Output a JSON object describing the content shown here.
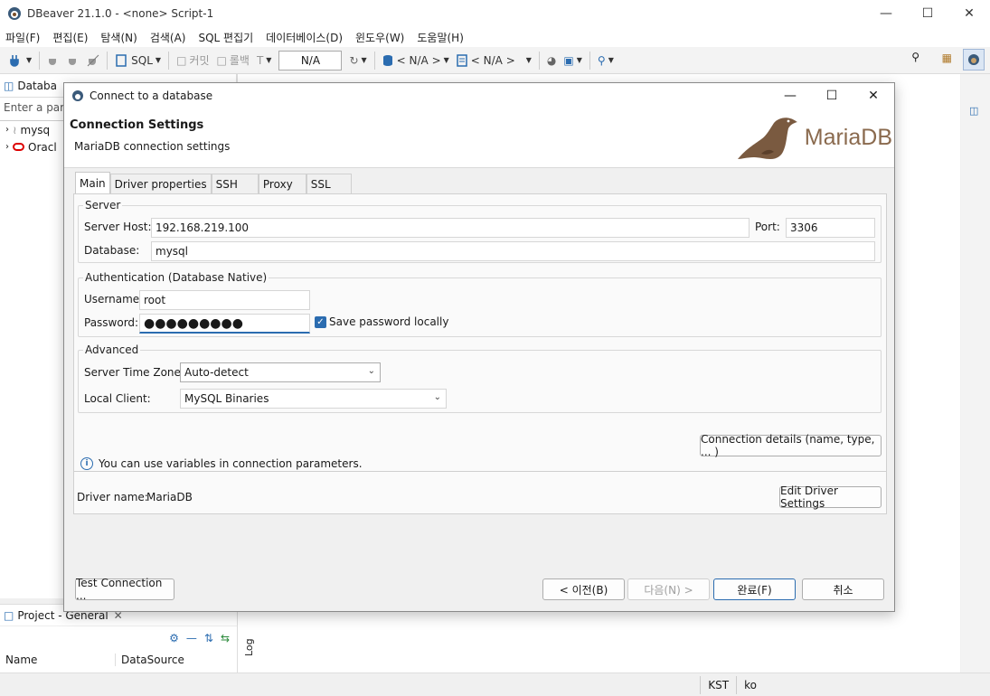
{
  "window": {
    "title": "DBeaver 21.1.0 - <none> Script-1"
  },
  "menu": [
    "파일(F)",
    "편집(E)",
    "탐색(N)",
    "검색(A)",
    "SQL 편집기",
    "데이터베이스(D)",
    "윈도우(W)",
    "도움말(H)"
  ],
  "toolbar": {
    "sql_label": "SQL",
    "commit_label": "커밋",
    "rollback_label": "롤백",
    "tx_combo_value": "N/A",
    "datasource_label": "< N/A >",
    "schema_label": "< N/A >"
  },
  "left_panel": {
    "tab_label": "Databa",
    "filter_placeholder": "Enter a part",
    "tree_items": [
      "mysq",
      "Oracl"
    ]
  },
  "project_panel": {
    "title": "Project - General",
    "col_name": "Name",
    "col_datasource": "DataSource",
    "log_label": "Log"
  },
  "status": {
    "timezone": "KST",
    "locale": "ko"
  },
  "dialog": {
    "title": "Connect to a database",
    "header_title": "Connection Settings",
    "header_subtitle": "MariaDB connection settings",
    "logo_text": "MariaDB",
    "tabs": [
      "Main",
      "Driver properties",
      "SSH",
      "Proxy",
      "SSL"
    ],
    "server": {
      "group_title": "Server",
      "host_label": "Server Host:",
      "host_value": "192.168.219.100",
      "port_label": "Port:",
      "port_value": "3306",
      "database_label": "Database:",
      "database_value": "mysql"
    },
    "auth": {
      "group_title": "Authentication (Database Native)",
      "username_label": "Username:",
      "username_value": "root",
      "password_label": "Password:",
      "password_value": "●●●●●●●●●",
      "save_password_label": "Save password locally",
      "save_password_checked": true
    },
    "advanced": {
      "group_title": "Advanced",
      "timezone_label": "Server Time Zone:",
      "timezone_value": "Auto-detect",
      "client_label": "Local Client:",
      "client_value": "MySQL Binaries"
    },
    "info_text": "You can use variables in connection parameters.",
    "connection_details_label": "Connection details (name, type, ... )",
    "driver_name_label": "Driver name:",
    "driver_name_value": "MariaDB",
    "edit_driver_label": "Edit Driver Settings",
    "buttons": {
      "test": "Test Connection ...",
      "back": "< 이전(B)",
      "next": "다음(N) >",
      "finish": "완료(F)",
      "cancel": "취소"
    }
  },
  "colors": {
    "accent": "#2b6cb0",
    "logo_brown": "#8a6a4e"
  }
}
